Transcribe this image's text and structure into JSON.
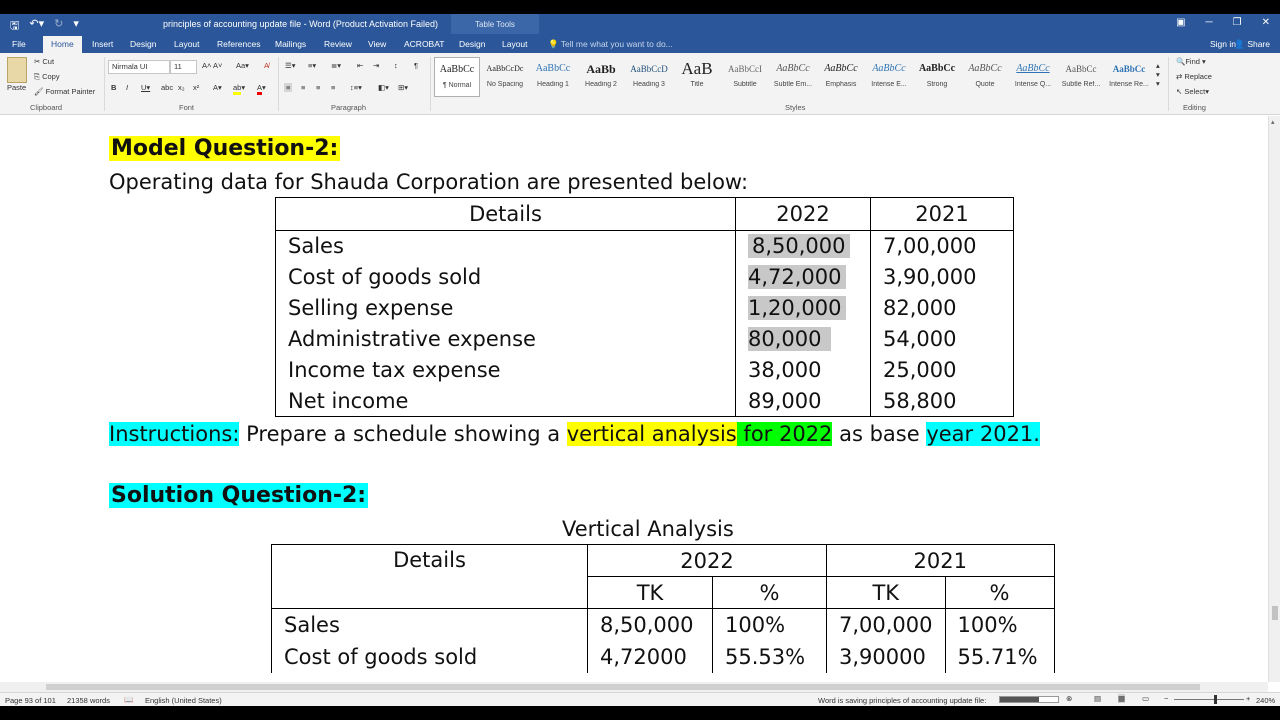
{
  "window": {
    "title": "principles of accounting update file - Word (Product Activation Failed)",
    "context_tab": "Table Tools",
    "signin": "Sign in",
    "share": "Share"
  },
  "tabs": [
    "File",
    "Home",
    "Insert",
    "Design",
    "Layout",
    "References",
    "Mailings",
    "Review",
    "View",
    "ACROBAT",
    "Design",
    "Layout"
  ],
  "tell_me": "Tell me what you want to do...",
  "ribbon": {
    "clipboard": {
      "paste": "Paste",
      "cut": "Cut",
      "copy": "Copy",
      "format_painter": "Format Painter",
      "label": "Clipboard"
    },
    "font": {
      "name": "Nirmala UI",
      "size": "11",
      "label": "Font"
    },
    "paragraph": {
      "label": "Paragraph"
    },
    "styles": {
      "label": "Styles",
      "items": [
        {
          "preview": "AaBbCc",
          "name": "¶ Normal"
        },
        {
          "preview": "AaBbCcDc",
          "name": "No Spacing"
        },
        {
          "preview": "AaBbCc",
          "name": "Heading 1"
        },
        {
          "preview": "AaBb",
          "name": "Heading 2"
        },
        {
          "preview": "AaBbCcD",
          "name": "Heading 3"
        },
        {
          "preview": "AaB",
          "name": "Title"
        },
        {
          "preview": "AaBbCcI",
          "name": "Subtitle"
        },
        {
          "preview": "AaBbCc",
          "name": "Subtle Em..."
        },
        {
          "preview": "AaBbCc",
          "name": "Emphasis"
        },
        {
          "preview": "AaBbCc",
          "name": "Intense E..."
        },
        {
          "preview": "AaBbCc",
          "name": "Strong"
        },
        {
          "preview": "AaBbCc",
          "name": "Quote"
        },
        {
          "preview": "AaBbCc",
          "name": "Intense Q..."
        },
        {
          "preview": "AaBbCc",
          "name": "Subtle Ref..."
        },
        {
          "preview": "AaBbCc",
          "name": "Intense Re..."
        }
      ]
    },
    "editing": {
      "find": "Find",
      "replace": "Replace",
      "select": "Select",
      "label": "Editing"
    }
  },
  "document": {
    "model_heading": "Model Question-2:",
    "intro": "Operating data for Shauda Corporation are presented below:",
    "table1": {
      "headers": [
        "Details",
        "2022",
        "2021"
      ],
      "rows": [
        [
          "Sales",
          "8,50,000",
          "7,00,000"
        ],
        [
          "Cost of goods sold",
          "4,72,000",
          "3,90,000"
        ],
        [
          "Selling expense",
          "1,20,000",
          "82,000"
        ],
        [
          "Administrative expense",
          "80,000",
          "54,000"
        ],
        [
          "Income tax expense",
          "38,000",
          "25,000"
        ],
        [
          "Net income",
          "89,000",
          "58,800"
        ]
      ]
    },
    "instructions": {
      "label": "Instructions:",
      "part1": " Prepare a schedule showing a ",
      "part2": "vertical analysis",
      "part3": " for 2022",
      "part4": " as base ",
      "part5": "year 2021."
    },
    "solution_heading": "Solution Question-2:",
    "table2": {
      "caption": "Vertical Analysis",
      "details_header": "Details",
      "year1": "2022",
      "year2": "2021",
      "sub": [
        "TK",
        "%",
        "TK",
        "%"
      ],
      "rows": [
        [
          "Sales",
          "8,50,000",
          "100%",
          "7,00,000",
          "100%"
        ],
        [
          "Cost of goods sold",
          "4,72000",
          "55.53%",
          "3,90000",
          "55.71%"
        ]
      ]
    }
  },
  "status": {
    "page": "Page 93 of 101",
    "words": "21358 words",
    "language": "English (United States)",
    "saving": "Word is saving principles of accounting update file:",
    "zoom": "240%"
  },
  "colors": {
    "accent": "#2b579a",
    "highlight_yellow": "#ffff00",
    "highlight_cyan": "#00ffff",
    "highlight_green": "#00ff00"
  }
}
